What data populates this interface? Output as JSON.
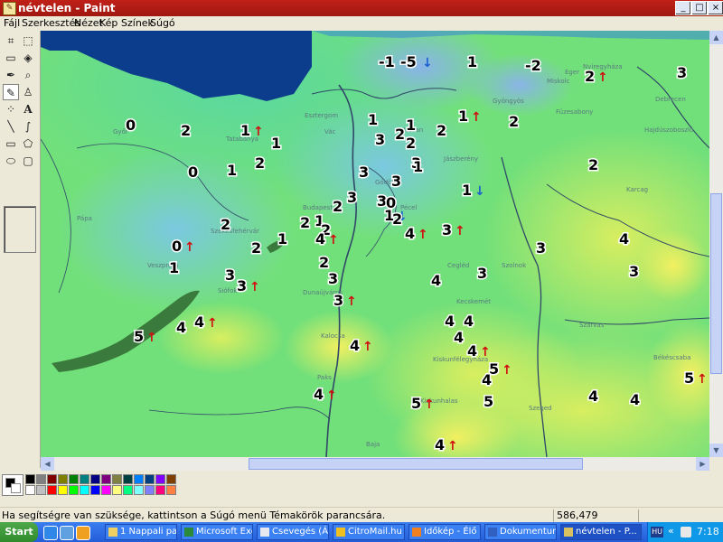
{
  "window": {
    "title": "névtelen - Paint",
    "buttons": {
      "minimize": "_",
      "maximize": "□",
      "close": "×"
    }
  },
  "menu": [
    "Fájl",
    "Szerkesztés",
    "Nézet",
    "Kép",
    "Színek",
    "Súgó"
  ],
  "tools": [
    "free-select",
    "select",
    "eraser",
    "fill",
    "color-picker",
    "magnifier",
    "pencil",
    "brush",
    "airbrush",
    "text",
    "line",
    "curve",
    "rectangle",
    "polygon",
    "ellipse",
    "rounded-rectangle"
  ],
  "active_tool": "pencil",
  "map": {
    "labels": [
      "-1",
      "-5",
      "1",
      "-2",
      "2",
      "3",
      "0",
      "2",
      "1",
      "1",
      "1",
      "3",
      "2",
      "1",
      "2",
      "2",
      "1",
      "2",
      "0",
      "1",
      "2",
      "3",
      "2",
      "3",
      "3",
      "1",
      "1",
      "2",
      "3",
      "3",
      "0",
      "1",
      "2",
      "2",
      "2",
      "1",
      "2",
      "4",
      "0",
      "2",
      "1",
      "4",
      "3",
      "2",
      "3",
      "3",
      "4",
      "3",
      "1",
      "3",
      "3",
      "3",
      "4",
      "3",
      "4",
      "4",
      "4",
      "4",
      "5",
      "4",
      "5",
      "4",
      "4",
      "4",
      "4",
      "5",
      "5",
      "4",
      "4",
      "5",
      "4"
    ],
    "arrows": {
      "up_color": "#d01010",
      "down_color": "#1a5fd0"
    },
    "towns": [
      "Nyíregyháza",
      "Miskolc",
      "Gyöngyös",
      "Eger",
      "Füzesabony",
      "Szolnok",
      "Cegléd",
      "Kecskemét",
      "Szeged",
      "Veszprém",
      "Siófok",
      "Kalocsa",
      "Dunaújváros",
      "Budapest",
      "Pécel",
      "Tatabánya",
      "Esztergom",
      "Győr",
      "Pápa",
      "Székesfehérvár",
      "Paks",
      "Baja",
      "Kiskunfélegyháza",
      "Kiskunhalas",
      "Békéscsaba",
      "Szarvas",
      "Debrecen",
      "Karcag",
      "Hajdúszoboszló",
      "Jászberény",
      "Hatvan",
      "Vác",
      "Gödöllő"
    ]
  },
  "palette": [
    "#000000",
    "#808080",
    "#800000",
    "#808000",
    "#008000",
    "#008080",
    "#000080",
    "#800080",
    "#808040",
    "#004040",
    "#0080ff",
    "#004080",
    "#8000ff",
    "#804000",
    "#ffffff",
    "#c0c0c0",
    "#ff0000",
    "#ffff00",
    "#00ff00",
    "#00ffff",
    "#0000ff",
    "#ff00ff",
    "#ffff80",
    "#00ff80",
    "#80ffff",
    "#8080ff",
    "#ff0080",
    "#ff8040"
  ],
  "status": {
    "help": "Ha segítségre van szüksége, kattintson a Súgó menü Témakörök parancsára.",
    "coords": "586,479"
  },
  "taskbar": {
    "start": "Start",
    "tasks": [
      "1 Nappali pap...",
      "Microsoft Exc...",
      "Csevegés (Á l...",
      "CitroMail.hu -...",
      "Időkép - Élő i...",
      "Dokumentum...",
      "névtelen - P..."
    ],
    "lang": "HU",
    "time": "7:18"
  }
}
